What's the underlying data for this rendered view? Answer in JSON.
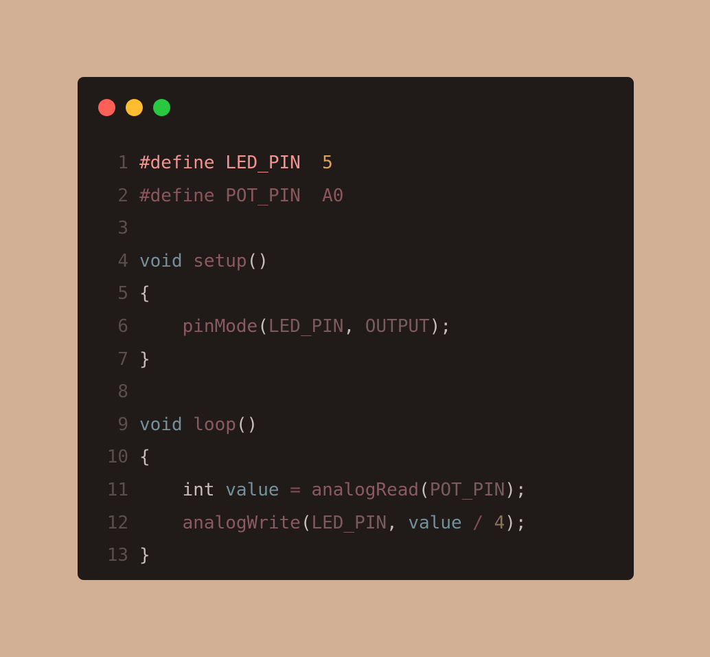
{
  "colors": {
    "background": "#d2b095",
    "window": "#201b19",
    "close": "#fe5f57",
    "minimize": "#febc2e",
    "maximize": "#28c840"
  },
  "window_controls": [
    {
      "name": "close-dot",
      "color": "#fe5f57"
    },
    {
      "name": "minimize-dot",
      "color": "#febc2e"
    },
    {
      "name": "maximize-dot",
      "color": "#28c840"
    }
  ],
  "code": {
    "lines": [
      {
        "num": "1",
        "tokens": [
          {
            "t": "#define LED_PIN  ",
            "c": "macro-active"
          },
          {
            "t": "5",
            "c": "const-active"
          }
        ]
      },
      {
        "num": "2",
        "tokens": [
          {
            "t": "#define POT_PIN  A0",
            "c": "macro"
          }
        ]
      },
      {
        "num": "3",
        "tokens": []
      },
      {
        "num": "4",
        "tokens": [
          {
            "t": "void",
            "c": "type"
          },
          {
            "t": " ",
            "c": "plain"
          },
          {
            "t": "setup",
            "c": "fn"
          },
          {
            "t": "()",
            "c": "punct"
          }
        ]
      },
      {
        "num": "5",
        "tokens": [
          {
            "t": "{",
            "c": "punct"
          }
        ]
      },
      {
        "num": "6",
        "tokens": [
          {
            "t": "    ",
            "c": "plain"
          },
          {
            "t": "pinMode",
            "c": "fn"
          },
          {
            "t": "(",
            "c": "punct"
          },
          {
            "t": "LED_PIN",
            "c": "ident"
          },
          {
            "t": ", ",
            "c": "punct"
          },
          {
            "t": "OUTPUT",
            "c": "ident"
          },
          {
            "t": ");",
            "c": "punct"
          }
        ]
      },
      {
        "num": "7",
        "tokens": [
          {
            "t": "}",
            "c": "punct"
          }
        ]
      },
      {
        "num": "8",
        "tokens": []
      },
      {
        "num": "9",
        "tokens": [
          {
            "t": "void",
            "c": "type"
          },
          {
            "t": " ",
            "c": "plain"
          },
          {
            "t": "loop",
            "c": "fn"
          },
          {
            "t": "()",
            "c": "punct"
          }
        ]
      },
      {
        "num": "10",
        "tokens": [
          {
            "t": "{",
            "c": "punct"
          }
        ]
      },
      {
        "num": "11",
        "tokens": [
          {
            "t": "    ",
            "c": "plain"
          },
          {
            "t": "int",
            "c": "kw"
          },
          {
            "t": " ",
            "c": "plain"
          },
          {
            "t": "value",
            "c": "var"
          },
          {
            "t": " ",
            "c": "plain"
          },
          {
            "t": "=",
            "c": "op"
          },
          {
            "t": " ",
            "c": "plain"
          },
          {
            "t": "analogRead",
            "c": "fn"
          },
          {
            "t": "(",
            "c": "punct"
          },
          {
            "t": "POT_PIN",
            "c": "ident"
          },
          {
            "t": ");",
            "c": "punct"
          }
        ]
      },
      {
        "num": "12",
        "tokens": [
          {
            "t": "    ",
            "c": "plain"
          },
          {
            "t": "analogWrite",
            "c": "fn"
          },
          {
            "t": "(",
            "c": "punct"
          },
          {
            "t": "LED_PIN",
            "c": "ident"
          },
          {
            "t": ", ",
            "c": "punct"
          },
          {
            "t": "value",
            "c": "var"
          },
          {
            "t": " ",
            "c": "plain"
          },
          {
            "t": "/",
            "c": "op"
          },
          {
            "t": " ",
            "c": "plain"
          },
          {
            "t": "4",
            "c": "num"
          },
          {
            "t": ");",
            "c": "punct"
          }
        ]
      },
      {
        "num": "13",
        "tokens": [
          {
            "t": "}",
            "c": "punct"
          }
        ]
      }
    ]
  }
}
